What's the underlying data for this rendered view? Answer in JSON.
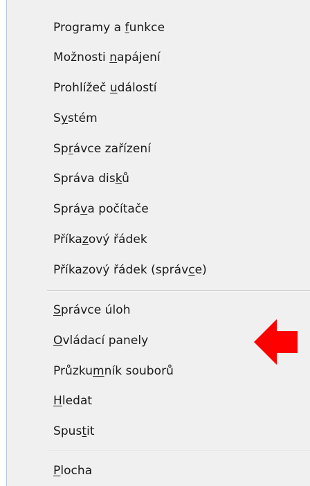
{
  "menu": {
    "items": [
      {
        "label": "Programy a funkce",
        "pre": "Programy a ",
        "accel": "f",
        "post": "unkce"
      },
      {
        "label": "Možnosti napájení",
        "pre": "Možnosti ",
        "accel": "n",
        "post": "apájení"
      },
      {
        "label": "Prohlížeč událostí",
        "pre": "Prohlížeč ",
        "accel": "u",
        "post": "dálostí"
      },
      {
        "label": "Systém",
        "pre": "S",
        "accel": "y",
        "post": "stém"
      },
      {
        "label": "Správce zařízení",
        "pre": "Sp",
        "accel": "r",
        "post": "ávce zařízení"
      },
      {
        "label": "Správa disků",
        "pre": "Správa dis",
        "accel": "k",
        "post": "ů"
      },
      {
        "label": "Správa počítače",
        "pre": "Sprá",
        "accel": "v",
        "post": "a počítače"
      },
      {
        "label": "Příkazový řádek",
        "pre": "Příka",
        "accel": "z",
        "post": "ový řádek"
      },
      {
        "label": "Příkazový řádek (správce)",
        "pre": "Příkazový řádek (správ",
        "accel": "c",
        "post": "e)"
      },
      {
        "label": "Správce úloh",
        "pre": "",
        "accel": "S",
        "post": "právce úloh"
      },
      {
        "label": "Ovládací panely",
        "pre": "",
        "accel": "O",
        "post": "vládací panely"
      },
      {
        "label": "Průzkumník souborů",
        "pre": "Průzku",
        "accel": "m",
        "post": "ník souborů"
      },
      {
        "label": "Hledat",
        "pre": "",
        "accel": "H",
        "post": "ledat"
      },
      {
        "label": "Spustit",
        "pre": "Spus",
        "accel": "t",
        "post": "it"
      },
      {
        "label": "Plocha",
        "pre": "",
        "accel": "P",
        "post": "locha"
      }
    ]
  },
  "annotation": {
    "arrow_color": "#ff0000",
    "arrow_icon": "left-arrow-icon"
  }
}
